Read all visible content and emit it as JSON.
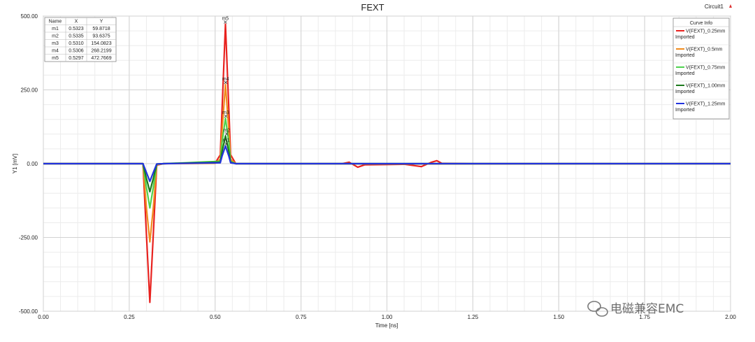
{
  "chart_data": {
    "type": "line",
    "title": "FEXT",
    "circuit_label": "Circuit1",
    "xlabel": "Time [ns]",
    "ylabel": "Y1 [mV]",
    "xlim": [
      0.0,
      2.0
    ],
    "ylim": [
      -500.0,
      500.0
    ],
    "x_ticks": [
      "0.00",
      "0.25",
      "0.50",
      "0.75",
      "1.00",
      "1.25",
      "1.50",
      "1.75",
      "2.00"
    ],
    "y_ticks": [
      "-500.00",
      "-250.00",
      "0.00",
      "250.00",
      "500.00"
    ],
    "grid": true,
    "legend_title": "Curve Info",
    "legend_position": "top-right",
    "series": [
      {
        "name": "V(FEXT)_0.25mm",
        "sub": "Imported",
        "color": "#e8221f",
        "points": [
          [
            0,
            0
          ],
          [
            0.29,
            0
          ],
          [
            0.3,
            -240
          ],
          [
            0.31,
            -470
          ],
          [
            0.32,
            -240
          ],
          [
            0.33,
            -5
          ],
          [
            0.35,
            0
          ],
          [
            0.5,
            2
          ],
          [
            0.515,
            30
          ],
          [
            0.52,
            180
          ],
          [
            0.53,
            472.8
          ],
          [
            0.54,
            180
          ],
          [
            0.545,
            30
          ],
          [
            0.56,
            0
          ],
          [
            0.87,
            0
          ],
          [
            0.89,
            5
          ],
          [
            0.915,
            -12
          ],
          [
            0.935,
            -4
          ],
          [
            1.0,
            -3
          ],
          [
            1.05,
            -2
          ],
          [
            1.1,
            -10
          ],
          [
            1.13,
            5
          ],
          [
            1.145,
            10
          ],
          [
            1.16,
            1
          ],
          [
            1.25,
            0
          ],
          [
            2.0,
            0
          ]
        ]
      },
      {
        "name": "V(FEXT)_0.5mm",
        "sub": "Imported",
        "color": "#f08c1e",
        "points": [
          [
            0,
            0
          ],
          [
            0.29,
            0
          ],
          [
            0.3,
            -150
          ],
          [
            0.31,
            -265
          ],
          [
            0.32,
            -150
          ],
          [
            0.33,
            -3
          ],
          [
            0.35,
            0
          ],
          [
            0.5,
            1
          ],
          [
            0.515,
            15
          ],
          [
            0.52,
            110
          ],
          [
            0.53,
            268.2
          ],
          [
            0.54,
            110
          ],
          [
            0.545,
            15
          ],
          [
            0.56,
            0
          ],
          [
            1.0,
            -1
          ],
          [
            2.0,
            0
          ]
        ]
      },
      {
        "name": "V(FEXT)_0.75mm",
        "sub": "Imported",
        "color": "#4fd24f",
        "points": [
          [
            0,
            0
          ],
          [
            0.29,
            0
          ],
          [
            0.3,
            -80
          ],
          [
            0.31,
            -150
          ],
          [
            0.32,
            -80
          ],
          [
            0.33,
            -2
          ],
          [
            0.35,
            0
          ],
          [
            0.515,
            8
          ],
          [
            0.52,
            70
          ],
          [
            0.53,
            154.1
          ],
          [
            0.54,
            70
          ],
          [
            0.545,
            8
          ],
          [
            0.56,
            0
          ],
          [
            2.0,
            0
          ]
        ]
      },
      {
        "name": "V(FEXT)_1.00mm",
        "sub": "Imported",
        "color": "#1d7a1d",
        "points": [
          [
            0,
            0
          ],
          [
            0.29,
            0
          ],
          [
            0.3,
            -50
          ],
          [
            0.31,
            -95
          ],
          [
            0.32,
            -50
          ],
          [
            0.33,
            -1
          ],
          [
            0.35,
            0
          ],
          [
            0.515,
            5
          ],
          [
            0.52,
            40
          ],
          [
            0.53,
            93.6
          ],
          [
            0.54,
            40
          ],
          [
            0.545,
            5
          ],
          [
            0.56,
            0
          ],
          [
            2.0,
            0
          ]
        ]
      },
      {
        "name": "V(FEXT)_1.25mm",
        "sub": "Imported",
        "color": "#2233dd",
        "points": [
          [
            0,
            0
          ],
          [
            0.29,
            0
          ],
          [
            0.3,
            -30
          ],
          [
            0.31,
            -60
          ],
          [
            0.32,
            -30
          ],
          [
            0.33,
            -1
          ],
          [
            0.35,
            0
          ],
          [
            0.515,
            3
          ],
          [
            0.52,
            25
          ],
          [
            0.53,
            59.9
          ],
          [
            0.54,
            25
          ],
          [
            0.545,
            3
          ],
          [
            0.56,
            0
          ],
          [
            2.0,
            0
          ]
        ]
      }
    ],
    "markers_table": {
      "headers": [
        "Name",
        "X",
        "Y"
      ],
      "rows": [
        [
          "m1",
          "0.5323",
          "59.8718"
        ],
        [
          "m2",
          "0.5335",
          "93.6375"
        ],
        [
          "m3",
          "0.5310",
          "154.0823"
        ],
        [
          "m4",
          "0.5306",
          "268.2199"
        ],
        [
          "m5",
          "0.5297",
          "472.7669"
        ]
      ]
    },
    "markers": [
      {
        "label": "m1",
        "x": 0.5323,
        "y": 59.8718
      },
      {
        "label": "m2",
        "x": 0.5335,
        "y": 93.6375
      },
      {
        "label": "m3",
        "x": 0.531,
        "y": 154.0823
      },
      {
        "label": "m4",
        "x": 0.5306,
        "y": 268.2199
      },
      {
        "label": "m5",
        "x": 0.5297,
        "y": 472.7669
      }
    ]
  },
  "watermark": "电磁兼容EMC"
}
